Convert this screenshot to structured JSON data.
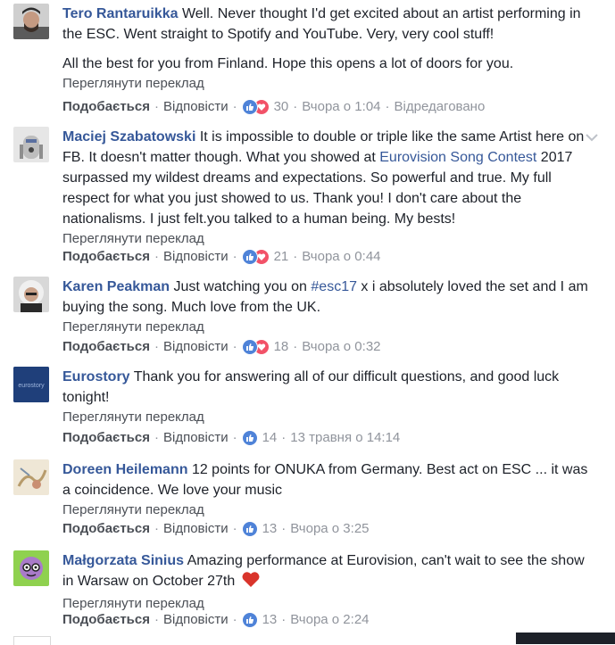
{
  "ui": {
    "like_label": "Подобається",
    "reply_label": "Відповісти",
    "translate_label": "Переглянути переклад",
    "separator": "·",
    "colors": {
      "link": "#365899",
      "like_reaction": "#4f83d8",
      "love_reaction": "#f25268"
    }
  },
  "comments": [
    {
      "author": "Tero Rantaruikka",
      "text": "Well. Never thought I'd get excited about an artist performing in the ESC. Went straight to Spotify and YouTube. Very, very cool stuff!",
      "text2": "All the best for you from Finland. Hope this opens a lot of doors for you.",
      "reactions": [
        "like",
        "love"
      ],
      "count": "30",
      "time": "Вчора о 1:04",
      "edited": "Відредаговано"
    },
    {
      "author": "Maciej Szabatowski",
      "text_a": "It is impossible to double or triple like the same Artist here on FB. It doesn't matter though. What you showed at ",
      "text_link": "Eurovision Song Contest",
      "text_b": " 2017 surpassed my wildest dreams and expectations. So powerful and true. My full respect for what you just showed to us. Thank you! I don't care about the nationalisms. I just felt.you talked to a human being. My bests!",
      "reactions": [
        "like",
        "love"
      ],
      "count": "21",
      "time": "Вчора о 0:44"
    },
    {
      "author": "Karen Peakman",
      "text_a": "Just watching you on ",
      "text_link": "#esc17",
      "text_b": " x i absolutely loved the set and I am buying the song. Much love from the UK.",
      "reactions": [
        "like",
        "love"
      ],
      "count": "18",
      "time": "Вчора о 0:32"
    },
    {
      "author": "Eurostory",
      "avatar_text": "eurostory",
      "text": "Thank you for answering all of our difficult questions, and good luck tonight!",
      "reactions": [
        "like"
      ],
      "count": "14",
      "time": "13 травня о 14:14"
    },
    {
      "author": "Doreen Heilemann",
      "text": "12 points for ONUKA from Germany. Best act on ESC ... it was a coincidence. We love your music",
      "reactions": [
        "like"
      ],
      "count": "13",
      "time": "Вчора о 3:25"
    },
    {
      "author": "Małgorzata Sinius",
      "text": "Amazing performance at Eurovision, can't wait to see the show in Warsaw on October 27th",
      "reactions": [
        "like"
      ],
      "count": "13",
      "time": "Вчора о 2:24"
    }
  ]
}
